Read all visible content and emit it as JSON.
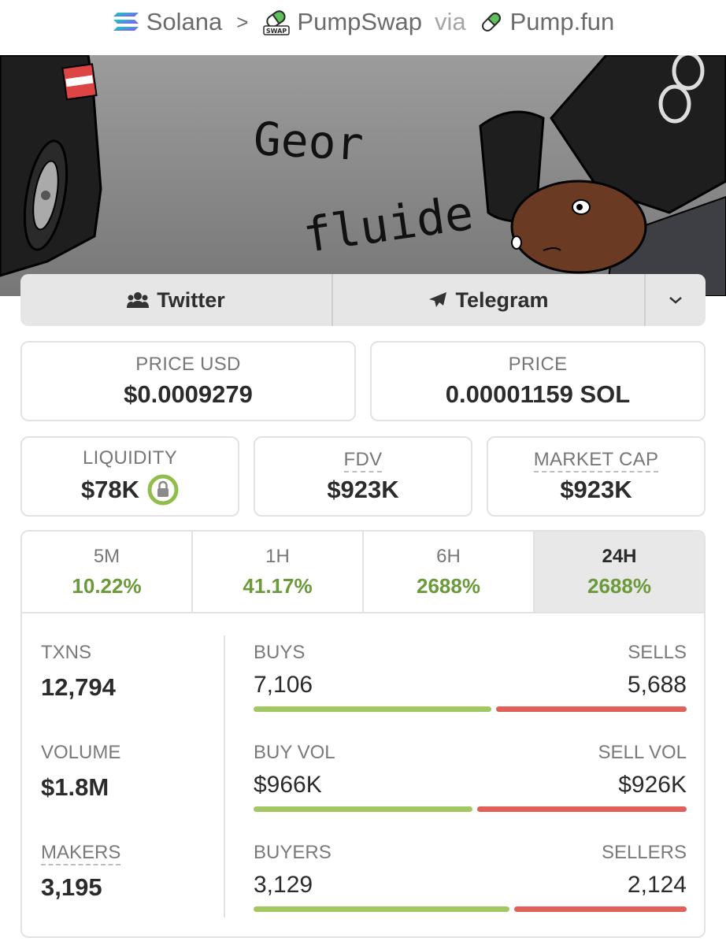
{
  "breadcrumb": {
    "chain": "Solana",
    "dex": "PumpSwap",
    "via_label": "via",
    "launchpad": "Pump.fun",
    "swap_badge": "SWAP",
    "separator": ">"
  },
  "banner": {
    "text_line1": "Geor",
    "text_line2": "fluide"
  },
  "social": {
    "twitter_label": "Twitter",
    "telegram_label": "Telegram"
  },
  "price": {
    "usd_label": "PRICE USD",
    "usd_value": "$0.0009279",
    "native_label": "PRICE",
    "native_value": "0.00001159 SOL"
  },
  "metrics": {
    "liquidity_label": "LIQUIDITY",
    "liquidity_value": "$78K",
    "fdv_label": "FDV",
    "fdv_value": "$923K",
    "mcap_label": "MARKET CAP",
    "mcap_value": "$923K"
  },
  "timeframes": [
    {
      "label": "5M",
      "change": "10.22%"
    },
    {
      "label": "1H",
      "change": "41.17%"
    },
    {
      "label": "6H",
      "change": "2688%"
    },
    {
      "label": "24H",
      "change": "2688%"
    }
  ],
  "active_timeframe": "24H",
  "stats": {
    "txns_label": "TXNS",
    "txns_value": "12,794",
    "volume_label": "VOLUME",
    "volume_value": "$1.8M",
    "makers_label": "MAKERS",
    "makers_value": "3,195"
  },
  "splits": {
    "buys_label": "BUYS",
    "buys_value": "7,106",
    "sells_label": "SELLS",
    "sells_value": "5,688",
    "buys_fraction": 0.555,
    "buyvol_label": "BUY VOL",
    "buyvol_value": "$966K",
    "sellvol_label": "SELL VOL",
    "sellvol_value": "$926K",
    "buyvol_fraction": 0.51,
    "buyers_label": "BUYERS",
    "buyers_value": "3,129",
    "sellers_label": "SELLERS",
    "sellers_value": "2,124",
    "buyers_fraction": 0.596
  },
  "colors": {
    "positive": "#6b9a3a",
    "buy_bar": "#a3c862",
    "sell_bar": "#e0605a",
    "lock": "#8fbf4a"
  }
}
